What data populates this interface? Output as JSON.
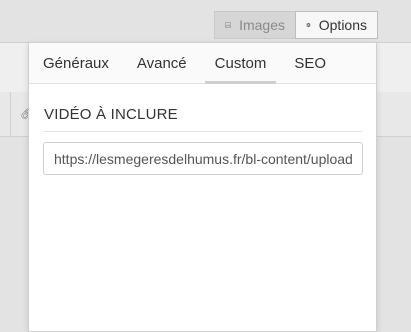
{
  "toolbar": {
    "images_label": "Images",
    "options_label": "Options",
    "images_icon": "image-icon",
    "options_icon": "gear-icon"
  },
  "tabs": [
    {
      "label": "Généraux",
      "active": false
    },
    {
      "label": "Avancé",
      "active": false
    },
    {
      "label": "Custom",
      "active": true
    },
    {
      "label": "SEO",
      "active": false
    }
  ],
  "section": {
    "title": "VIDÉO À INCLURE"
  },
  "video_url": {
    "value": "https://lesmegeresdelhumus.fr/bl-content/uploads/"
  },
  "colors": {
    "panel_bg": "#ffffff",
    "page_bg": "#e3e3e3",
    "active_tab_underline": "#cfcfcf"
  }
}
